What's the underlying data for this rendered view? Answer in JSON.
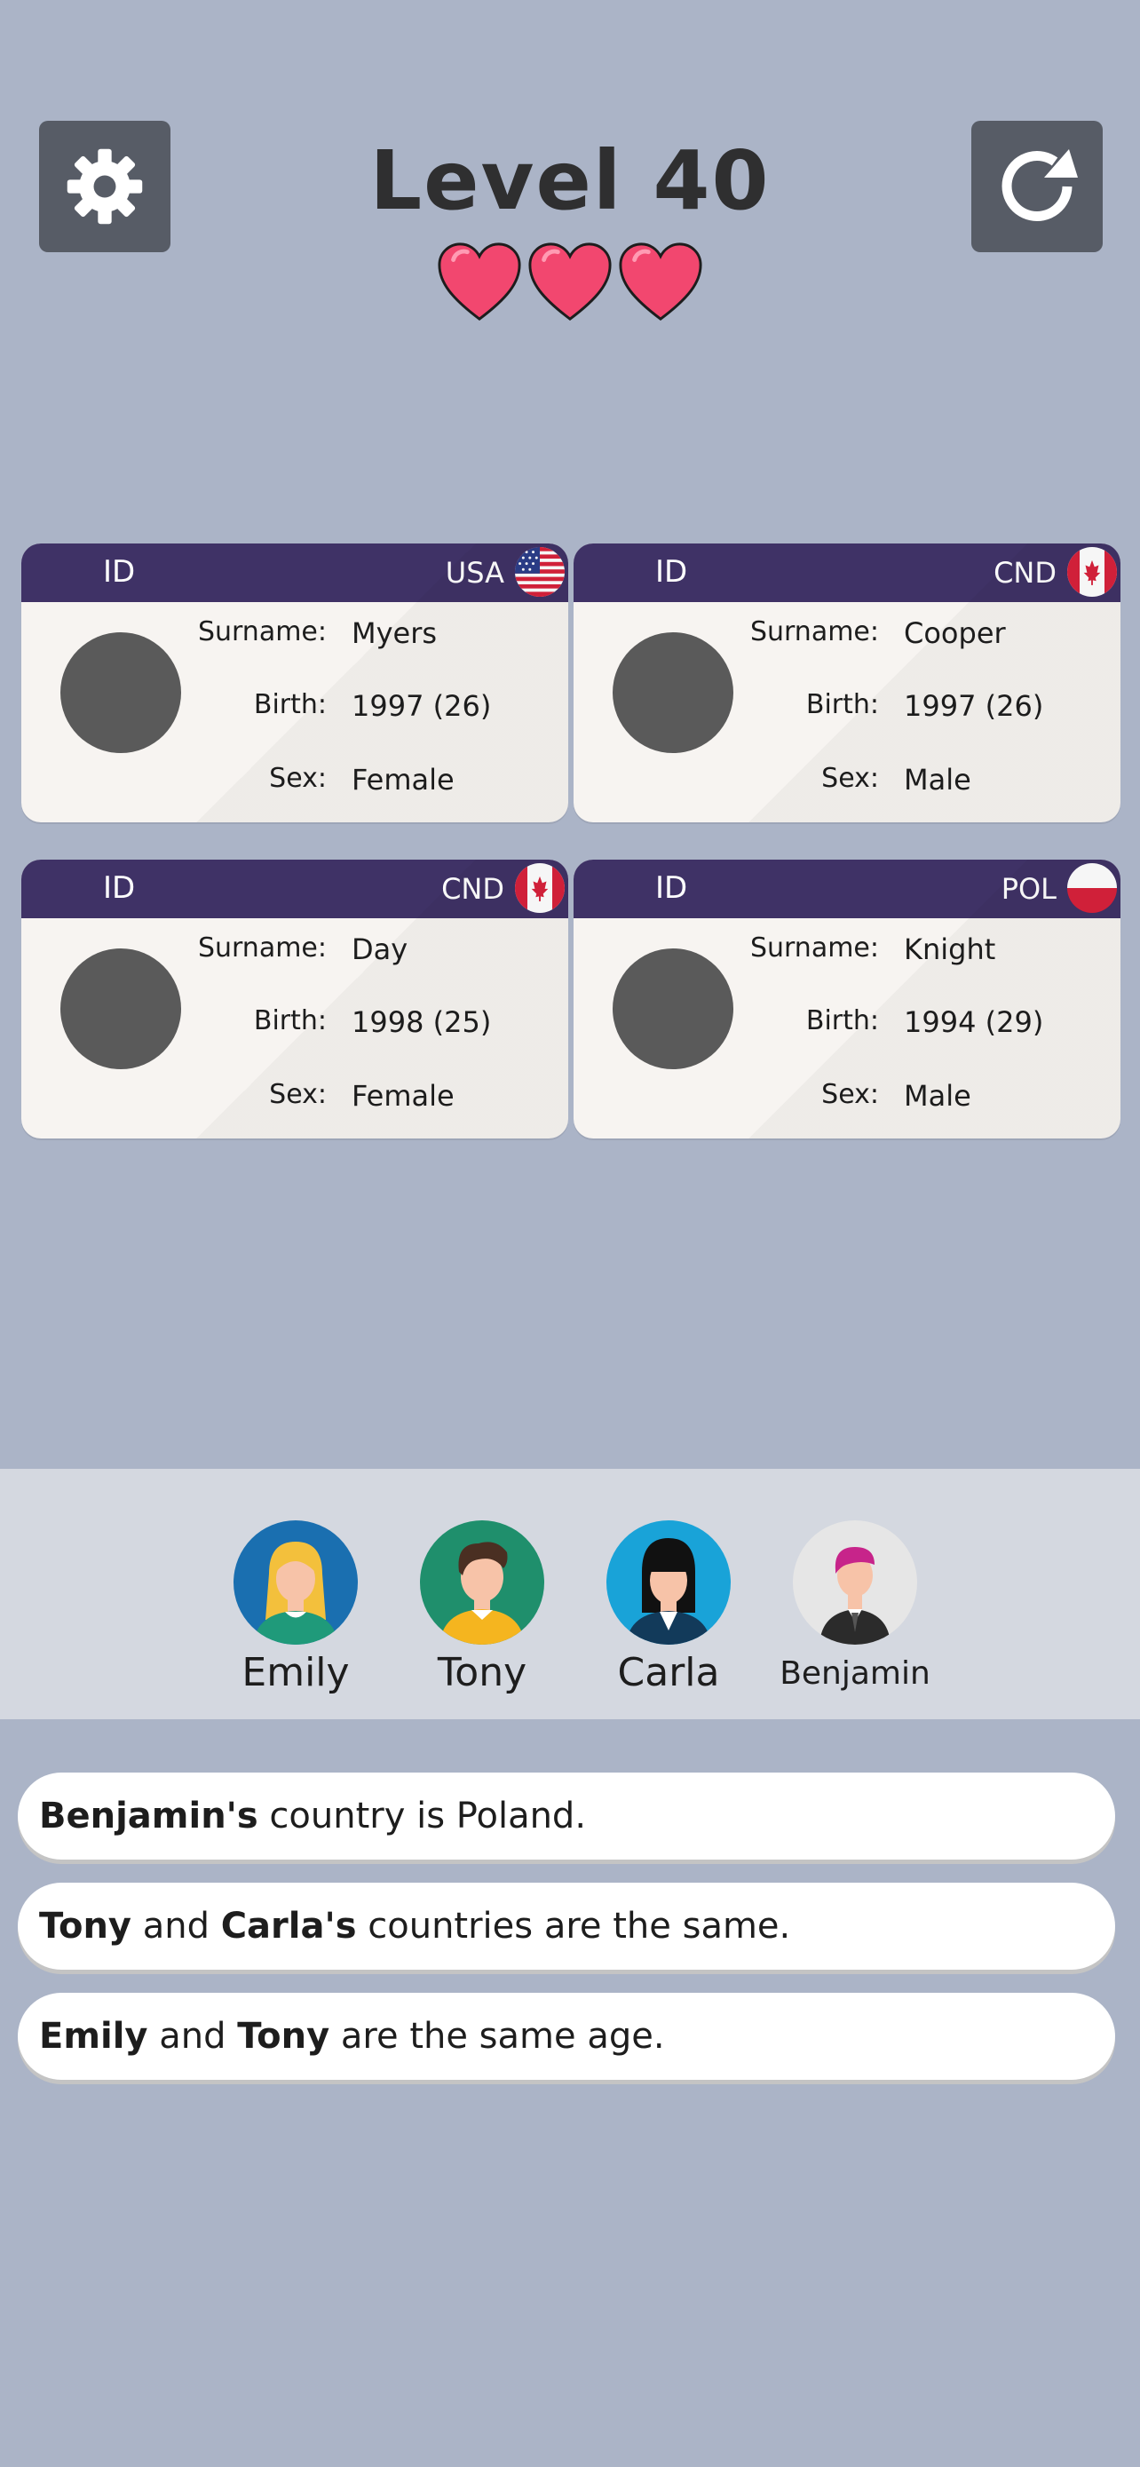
{
  "header": {
    "level": "Level 40",
    "lives": 3,
    "settings_icon": "gear-icon",
    "restart_icon": "restart-icon"
  },
  "cards": [
    {
      "id_label": "ID",
      "country": "USA",
      "flag": "usa-flag-icon",
      "surname_label": "Surname:",
      "surname": "Myers",
      "birth_label": "Birth:",
      "birth": "1997 (26)",
      "sex_label": "Sex:",
      "sex": "Female"
    },
    {
      "id_label": "ID",
      "country": "CND",
      "flag": "canada-flag-icon",
      "surname_label": "Surname:",
      "surname": "Cooper",
      "birth_label": "Birth:",
      "birth": "1997 (26)",
      "sex_label": "Sex:",
      "sex": "Male"
    },
    {
      "id_label": "ID",
      "country": "CND",
      "flag": "canada-flag-icon",
      "surname_label": "Surname:",
      "surname": "Day",
      "birth_label": "Birth:",
      "birth": "1998 (25)",
      "sex_label": "Sex:",
      "sex": "Female"
    },
    {
      "id_label": "ID",
      "country": "POL",
      "flag": "poland-flag-icon",
      "surname_label": "Surname:",
      "surname": "Knight",
      "birth_label": "Birth:",
      "birth": "1994 (29)",
      "sex_label": "Sex:",
      "sex": "Male"
    }
  ],
  "people": [
    {
      "name": "Emily",
      "avatar_color": "#1a6fb0"
    },
    {
      "name": "Tony",
      "avatar_color": "#1f8f6c"
    },
    {
      "name": "Carla",
      "avatar_color": "#19a3d8"
    },
    {
      "name": "Benjamin",
      "avatar_color": "#e6e6e6"
    }
  ],
  "clues": [
    {
      "bold1": "Benjamin's",
      "text1": " country is Poland."
    },
    {
      "bold1": "Tony",
      "text1": " and ",
      "bold2": "Carla's",
      "text2": " countries are the same."
    },
    {
      "bold1": "Emily",
      "text1": " and ",
      "bold2": "Tony",
      "text2": " are the same age."
    }
  ],
  "colors": {
    "background": "#abb4c7",
    "card_header": "#3f3266",
    "heart": "#f2476f"
  }
}
